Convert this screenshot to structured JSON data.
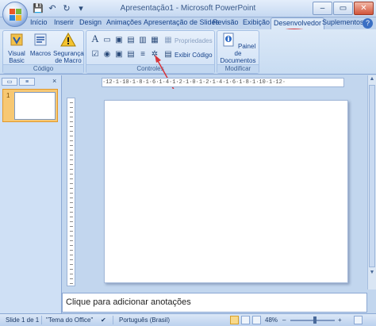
{
  "window": {
    "title": "Apresentação1 - Microsoft PowerPoint",
    "qat": {
      "save_glyph": "💾",
      "undo_glyph": "↶",
      "redo_glyph": "↻",
      "more_glyph": "▾"
    },
    "controls": {
      "minimize": "–",
      "maximize": "▭",
      "close": "✕"
    }
  },
  "tabs": [
    "Início",
    "Inserir",
    "Design",
    "Animações",
    "Apresentação de Slides",
    "Revisão",
    "Exibição",
    "Desenvolvedor",
    "Suplementos"
  ],
  "active_tab": "Desenvolvedor",
  "help": "?",
  "ribbon": {
    "codigo": {
      "label": "Código",
      "visual_basic": "Visual Basic",
      "macros": "Macros",
      "seguranca": "Segurança de Macro"
    },
    "controles": {
      "label": "Controles",
      "propriedades": "Propriedades",
      "exibir_codigo": "Exibir Código"
    },
    "modificar": {
      "label": "Modificar",
      "painel": "Painel de Documentos"
    }
  },
  "left_panel": {
    "slide_number": "1",
    "close": "×"
  },
  "ruler": {
    "horizontal": "·12·1·10·1·8·1·6·1·4·1·2·1·0·1·2·1·4·1·6·1·8·1·10·1·12·"
  },
  "notes": {
    "placeholder": "Clique para adicionar anotações"
  },
  "status": {
    "slide": "Slide 1 de 1",
    "theme": "\"Tema do Office\"",
    "language": "Português (Brasil)",
    "zoom": "48%",
    "zoom_minus": "–",
    "zoom_plus": "+"
  },
  "colors": {
    "highlight": "#d8343a",
    "ribbon": "#dbe8f7",
    "accent": "#15428b"
  }
}
